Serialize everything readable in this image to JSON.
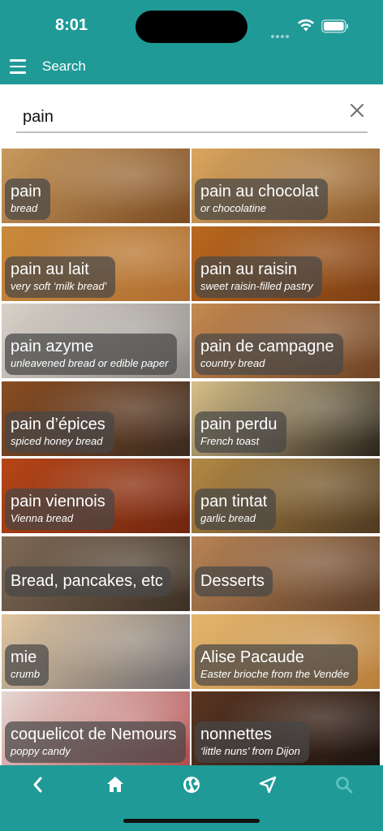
{
  "status": {
    "time": "8:01"
  },
  "app_bar": {
    "title": "Search",
    "icon": "hamburger-menu-icon"
  },
  "search": {
    "value": "pain",
    "clear_icon": "close-icon"
  },
  "tiles": [
    {
      "title": "pain",
      "subtitle": "bread",
      "colors": [
        "#c99a5e",
        "#7a4a22"
      ]
    },
    {
      "title": "pain au chocolat",
      "subtitle": "or chocolatine",
      "colors": [
        "#d9a760",
        "#8b5a2b"
      ]
    },
    {
      "title": "pain au lait",
      "subtitle": "very soft ‘milk bread’",
      "colors": [
        "#c98a3c",
        "#b06f33"
      ]
    },
    {
      "title": "pain au raisin",
      "subtitle": "sweet raisin-filled pastry",
      "colors": [
        "#b9681e",
        "#7d3f14"
      ]
    },
    {
      "title": "pain azyme",
      "subtitle": "unleavened bread or edible paper",
      "colors": [
        "#d8d2c9",
        "#8f8a86"
      ]
    },
    {
      "title": "pain de campagne",
      "subtitle": "country bread",
      "colors": [
        "#c58a52",
        "#6e4324"
      ]
    },
    {
      "title": "pain d’épices",
      "subtitle": "spiced honey bread",
      "colors": [
        "#8a4d22",
        "#3a2a20"
      ]
    },
    {
      "title": "pain perdu",
      "subtitle": "French toast",
      "colors": [
        "#d8c08a",
        "#2a241c"
      ]
    },
    {
      "title": "pain viennois",
      "subtitle": "Vienna bread",
      "colors": [
        "#b74617",
        "#6f2610"
      ]
    },
    {
      "title": "pan tintat",
      "subtitle": "garlic bread",
      "colors": [
        "#b48a45",
        "#4e3a22"
      ]
    },
    {
      "title": "Bread, pancakes, etc",
      "subtitle": "",
      "colors": [
        "#7f6a55",
        "#3c3026"
      ]
    },
    {
      "title": "Desserts",
      "subtitle": "",
      "colors": [
        "#b88455",
        "#5a3c28"
      ]
    },
    {
      "title": "mie",
      "subtitle": "crumb",
      "colors": [
        "#e1c6a0",
        "#6d6a6e"
      ]
    },
    {
      "title": "Alise Pacaude",
      "subtitle": "Easter brioche from the Vendée",
      "colors": [
        "#e3b66f",
        "#b97f3c"
      ]
    },
    {
      "title": "coquelicot de Nemours",
      "subtitle": "poppy candy",
      "colors": [
        "#e6d8d4",
        "#b24a4a"
      ]
    },
    {
      "title": "nonnettes",
      "subtitle": "‘little nuns’ from Dijon",
      "colors": [
        "#5a3522",
        "#1d1410"
      ]
    }
  ],
  "nav": {
    "icons": [
      "back-chevron-icon",
      "home-icon",
      "globe-icon",
      "location-arrow-icon",
      "search-icon"
    ],
    "colors": {
      "active": "#ffffff",
      "inactive": "#5fc3c0"
    }
  },
  "theme": {
    "primary": "#1f9a97"
  }
}
